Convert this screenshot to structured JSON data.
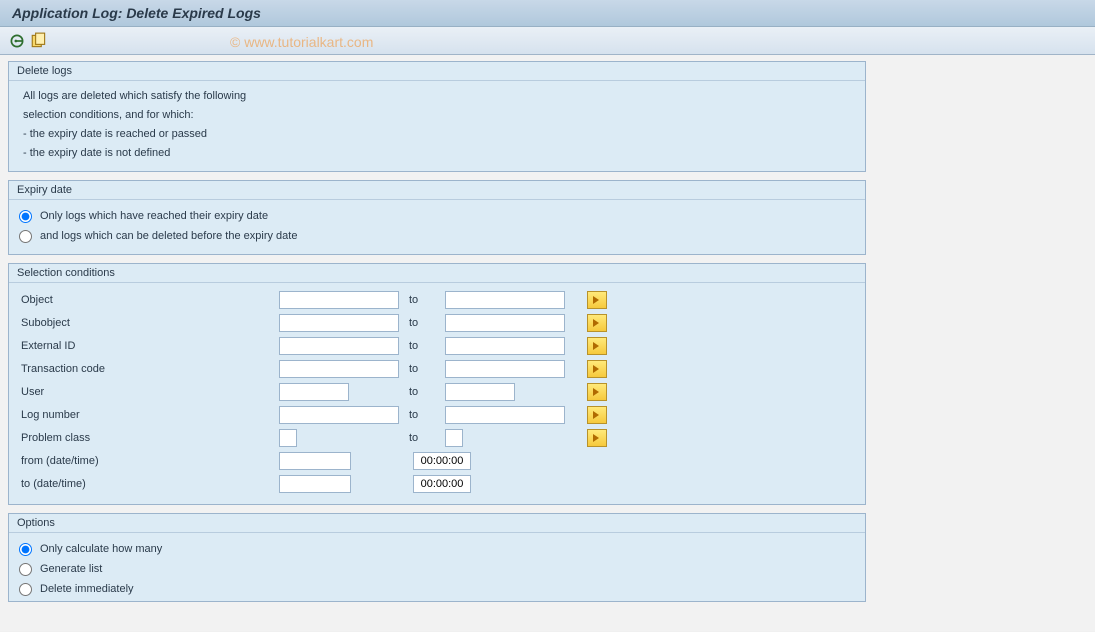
{
  "title": "Application Log: Delete Expired Logs",
  "watermark": "© www.tutorialkart.com",
  "toolbar": {
    "execute_icon": "execute",
    "variant_icon": "variant"
  },
  "delete_logs": {
    "title": "Delete logs",
    "line1": "All logs are deleted which satisfy the following",
    "line2": "selection conditions, and for which:",
    "bullet1": " - the expiry date is reached or passed",
    "bullet2": " - the expiry date is not defined"
  },
  "expiry": {
    "title": "Expiry date",
    "opt1": "Only logs which have reached their expiry date",
    "opt2": "and logs which can be deleted before the expiry date"
  },
  "selection": {
    "title": "Selection conditions",
    "to_label": "to",
    "rows": [
      {
        "label": "Object"
      },
      {
        "label": "Subobject"
      },
      {
        "label": "External ID"
      },
      {
        "label": "Transaction code"
      },
      {
        "label": "User"
      },
      {
        "label": "Log number"
      },
      {
        "label": "Problem class"
      }
    ],
    "from_dt_label": "from (date/time)",
    "to_dt_label": "to (date/time)",
    "time_default": "00:00:00"
  },
  "options": {
    "title": "Options",
    "opt1": "Only calculate how many",
    "opt2": "Generate list",
    "opt3": "Delete immediately"
  }
}
